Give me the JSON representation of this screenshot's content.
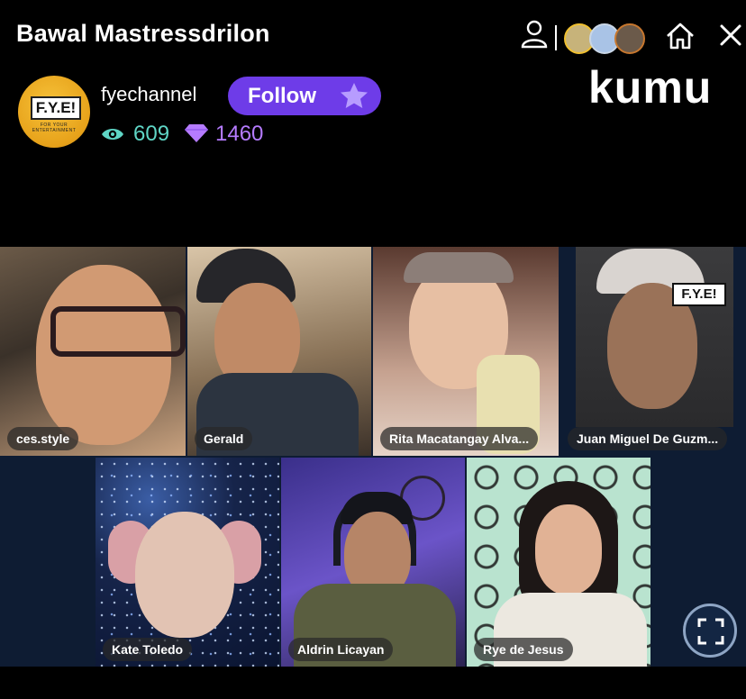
{
  "stream": {
    "title": "Bawal Mastressdrilon",
    "brand": "kumu"
  },
  "host": {
    "channel_name": "fyechannel",
    "avatar_text": "F.Y.E!",
    "avatar_subtext": "FOR YOUR ENTERTAINMENT",
    "follow_label": "Follow",
    "views": "609",
    "gems": "1460"
  },
  "icons": {
    "profile": "user-icon",
    "badges": [
      "gold-badge-icon",
      "silver-badge-icon",
      "bronze-badge-icon"
    ],
    "home": "home-icon",
    "close": "close-icon",
    "views": "eye-icon",
    "gems": "diamond-icon",
    "follow": "star-icon",
    "fullscreen": "fullscreen-icon"
  },
  "participants": [
    {
      "name": "ces.style"
    },
    {
      "name": "Gerald"
    },
    {
      "name": "Rita Macatangay Alva..."
    },
    {
      "name": "Juan Miguel De Guzm..."
    },
    {
      "name": "Kate Toledo"
    },
    {
      "name": "Aldrin Licayan"
    },
    {
      "name": "Rye de Jesus"
    }
  ],
  "colors": {
    "background": "#000000",
    "follow_button": "#6e3ce8",
    "views_color": "#5fd6c6",
    "gems_color": "#b57bff",
    "grid_background": "#0e1c33"
  }
}
